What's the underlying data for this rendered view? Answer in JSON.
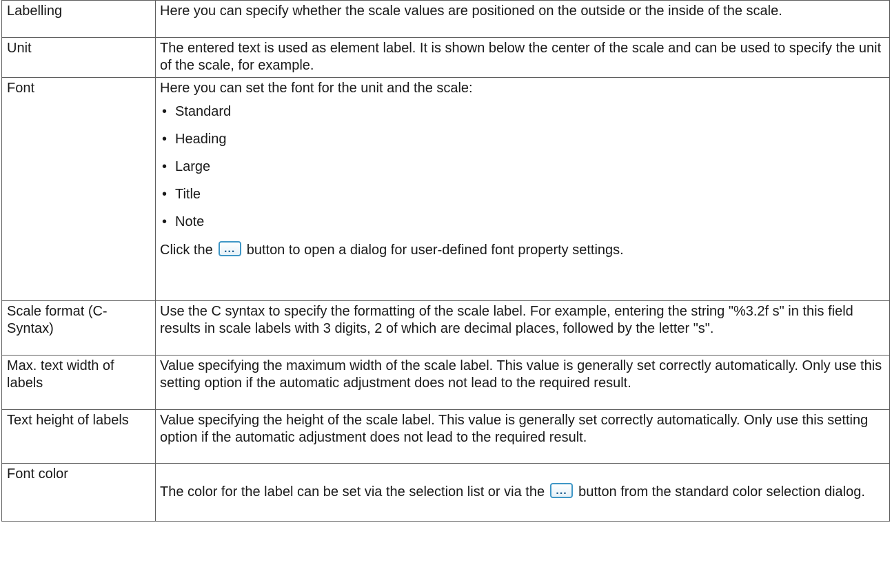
{
  "rows": [
    {
      "name": "Labelling",
      "description": "Here you can specify whether the scale values are positioned on the outside or the inside of the scale."
    },
    {
      "name": "Unit",
      "description": "The entered text is used as element label. It is shown below the center of the scale and can be used to specify the unit of the scale, for example."
    },
    {
      "name": "Font",
      "description": "Here you can set the font for the unit and the scale:",
      "options": [
        "Standard",
        "Heading",
        "Large",
        "Title",
        "Note"
      ],
      "bullet": "•",
      "click_before": "Click the",
      "click_after": "button to open a dialog for user-defined font property settings."
    },
    {
      "name": "Scale format (C-Syntax)",
      "description": "Use the C syntax to specify the formatting of the scale label. For example, entering the string \"%3.2f s\" in this field results in scale labels with 3 digits, 2 of which are decimal places, followed by the letter \"s\"."
    },
    {
      "name": "Max. text width of labels",
      "description": "Value specifying the maximum width of the scale label. This value is generally set correctly automatically. Only use this setting option if the automatic adjustment does not lead to the required result."
    },
    {
      "name": "Text height of labels",
      "description": "Value specifying the height of the scale label. This value is generally set correctly automatically. Only use this setting option if the automatic adjustment does not lead to the required result."
    },
    {
      "name": "Font color",
      "description_before": "The color for the label can be set via the selection list or via the",
      "description_after": "button from the standard color selection dialog."
    }
  ],
  "ellipsis_button": {
    "glyph": "...",
    "icon": "ellipsis-button-icon",
    "border_color": "#3e96c6"
  }
}
